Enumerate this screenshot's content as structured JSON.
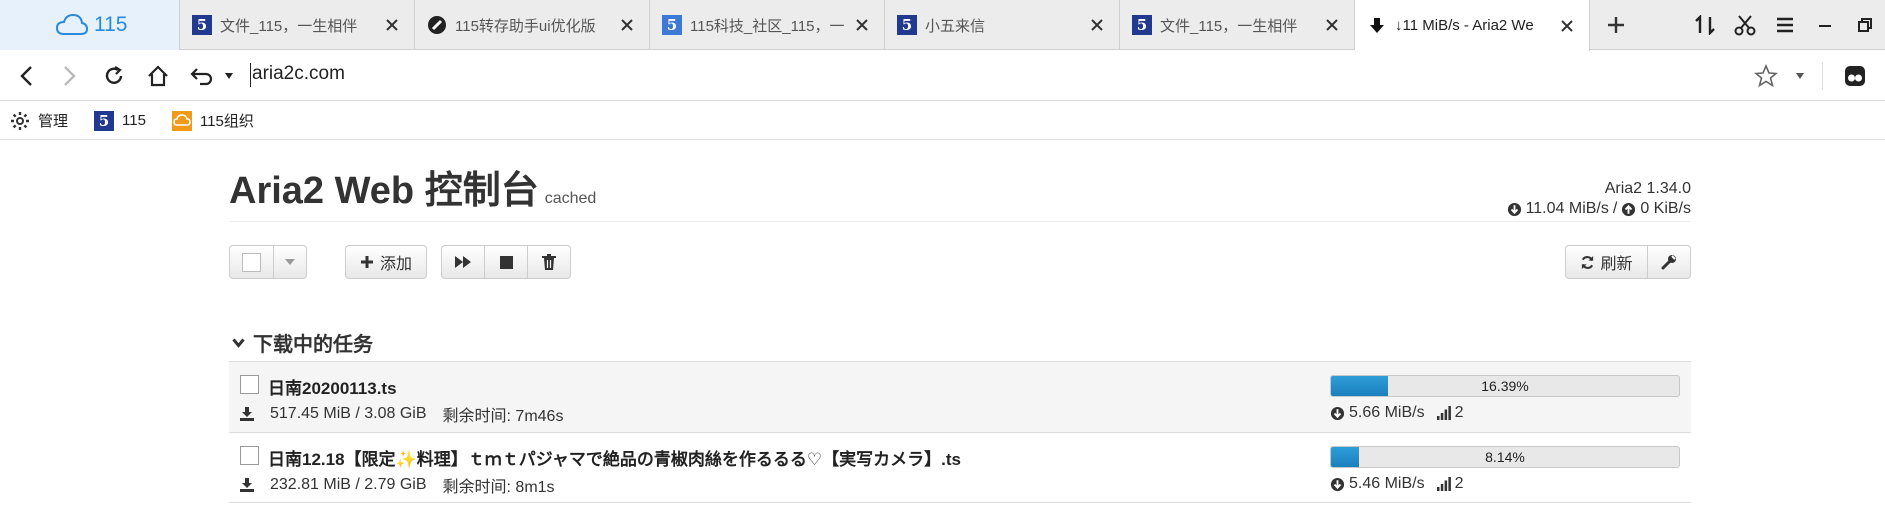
{
  "browser": {
    "home_tab_label": "115",
    "tabs": [
      {
        "title": "文件_115，一生相伴",
        "icon": "115-logo-icon",
        "active": false
      },
      {
        "title": "115转存助手ui优化版",
        "icon": "tampermonkey-icon",
        "active": false
      },
      {
        "title": "115科技_社区_115，一",
        "icon": "115-logo-icon",
        "active": false
      },
      {
        "title": "小五来信",
        "icon": "115-logo-icon",
        "active": false
      },
      {
        "title": "文件_115，一生相伴",
        "icon": "115-logo-icon",
        "active": false
      },
      {
        "title": "↓11 MiB/s - Aria2 We",
        "icon": "download-arrow-icon",
        "active": true
      }
    ],
    "url": "aria2c.com",
    "bookmarks": [
      {
        "label": "管理",
        "icon": "gear-icon"
      },
      {
        "label": "115",
        "icon": "115-logo-icon"
      },
      {
        "label": "115组织",
        "icon": "115-cloud-orange-icon"
      }
    ]
  },
  "app": {
    "title": "Aria2 Web 控制台",
    "title_tag": "cached",
    "version": "Aria2 1.34.0",
    "download_speed": "11.04 MiB/s",
    "speed_separator": "/",
    "upload_speed": "0 KiB/s",
    "toolbar": {
      "add_label": "添加",
      "refresh_label": "刷新"
    },
    "section_title": "下载中的任务",
    "tasks": [
      {
        "name": "日南20200113.ts",
        "size": "517.45 MiB / 3.08 GiB",
        "remaining": "剩余时间: 7m46s",
        "progress_text": "16.39%",
        "progress": 0.1639,
        "speed": "5.66 MiB/s",
        "connections": "2"
      },
      {
        "name": "日南12.18【限定✨料理】ｔｍｔパジャマで絶品の青椒肉絲を作るるる♡【実写カメラ】.ts",
        "size": "232.81 MiB / 2.79 GiB",
        "remaining": "剩余时间: 8m1s",
        "progress_text": "8.14%",
        "progress": 0.0814,
        "speed": "5.46 MiB/s",
        "connections": "2"
      }
    ]
  },
  "colors": {
    "progress_fill": "#1f86c6",
    "brand_blue": "#2a8ad9",
    "tab_favicon_blue": "#213a8f",
    "bookmark_orange": "#f19a1a"
  }
}
